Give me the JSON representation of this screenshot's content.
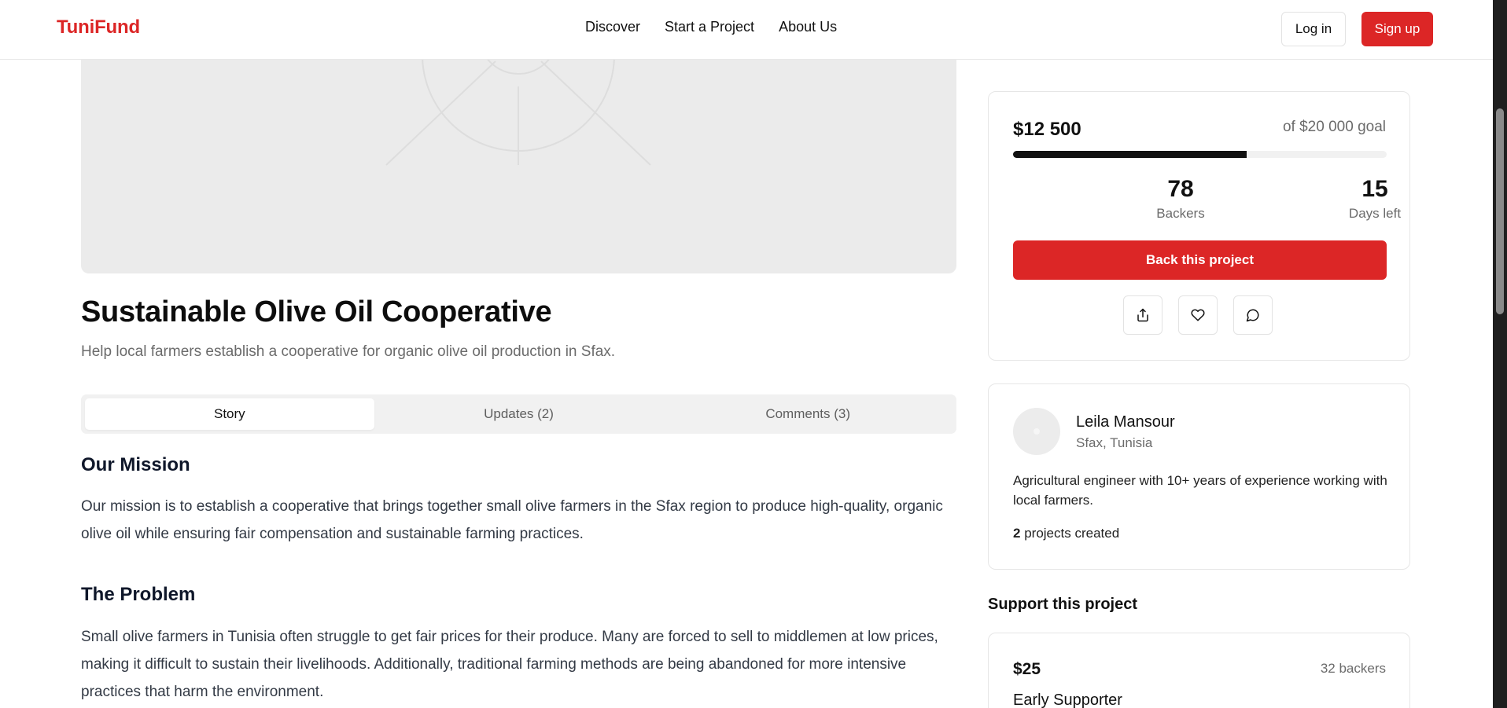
{
  "header": {
    "logo": "TuniFund",
    "nav": [
      "Discover",
      "Start a Project",
      "About Us"
    ],
    "login_label": "Log in",
    "signup_label": "Sign up"
  },
  "project": {
    "title": "Sustainable Olive Oil Cooperative",
    "subtitle": "Help local farmers establish a cooperative for organic olive oil production in Sfax."
  },
  "tabs": [
    {
      "label": "Story",
      "active": true
    },
    {
      "label": "Updates (2)",
      "active": false
    },
    {
      "label": "Comments (3)",
      "active": false
    }
  ],
  "story": {
    "mission_heading": "Our Mission",
    "mission_text": "Our mission is to establish a cooperative that brings together small olive farmers in the Sfax region to produce high-quality, organic olive oil while ensuring fair compensation and sustainable farming practices.",
    "problem_heading": "The Problem",
    "problem_text": "Small olive farmers in Tunisia often struggle to get fair prices for their produce. Many are forced to sell to middlemen at low prices, making it difficult to sustain their livelihoods. Additionally, traditional farming methods are being abandoned for more intensive practices that harm the environment."
  },
  "funding": {
    "raised": "$12 500",
    "goal_text": "of $20 000 goal",
    "progress_fraction": 0.625,
    "backers_count": "78",
    "backers_label": "Backers",
    "days_left": "15",
    "days_label": "Days left",
    "back_button": "Back this project",
    "actions": [
      "share-icon",
      "heart-icon",
      "comment-icon"
    ]
  },
  "creator": {
    "name": "Leila Mansour",
    "location": "Sfax, Tunisia",
    "bio": "Agricultural engineer with 10+ years of experience working with local farmers.",
    "projects_count": "2",
    "projects_label": "projects created"
  },
  "support": {
    "heading": "Support this project",
    "rewards": [
      {
        "amount": "$25",
        "backers": "32 backers",
        "name": "Early Supporter"
      }
    ]
  },
  "colors": {
    "brand": "#dc2626",
    "progress": "#111111",
    "muted_text": "#6b6b6b"
  }
}
